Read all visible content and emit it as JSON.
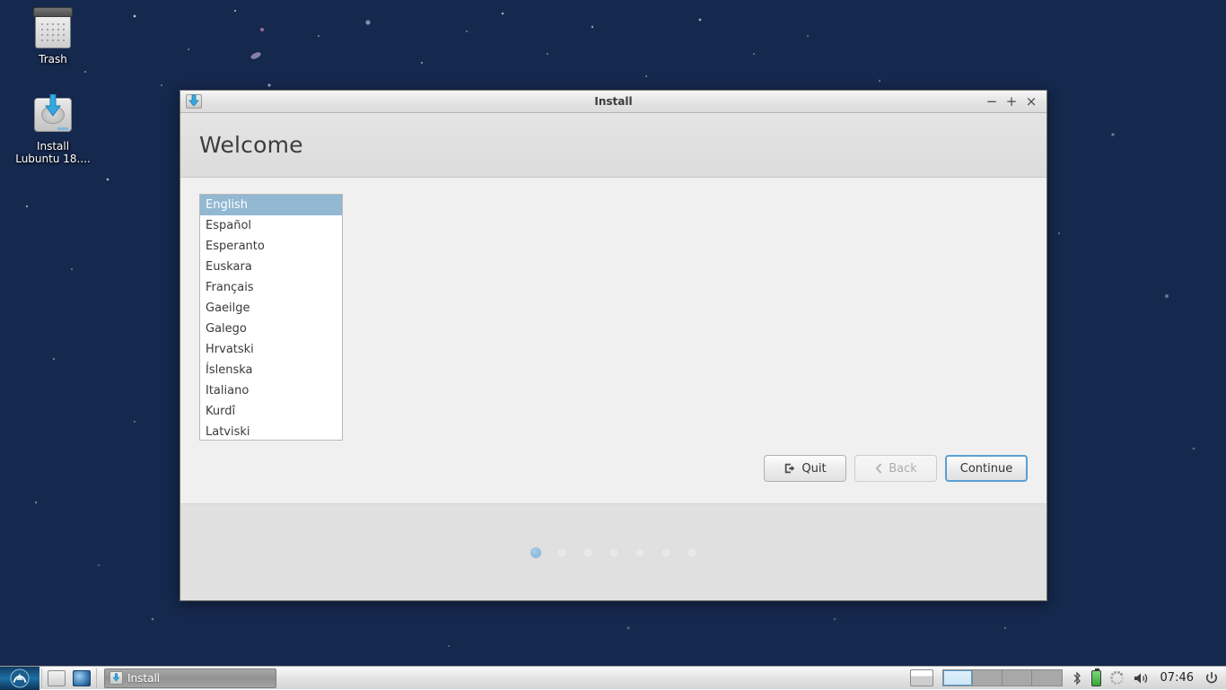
{
  "desktop": {
    "icons": [
      {
        "name": "trash",
        "label": "Trash"
      },
      {
        "name": "install-lubuntu",
        "label": "Install\nLubuntu 18...."
      }
    ],
    "wallpaper_colors": {
      "top_left": "#123a5c",
      "top_right": "#8a2ad2",
      "bottom_left": "#4a0c6d",
      "bottom_right": "#2a0943"
    }
  },
  "window": {
    "title": "Install",
    "icon": "installer-icon",
    "controls": {
      "minimize": "−",
      "maximize": "+",
      "close": "×"
    },
    "page_title": "Welcome",
    "language_list": {
      "selected": "English",
      "items": [
        "English",
        "Español",
        "Esperanto",
        "Euskara",
        "Français",
        "Gaeilge",
        "Galego",
        "Hrvatski",
        "Íslenska",
        "Italiano",
        "Kurdî",
        "Latviski"
      ]
    },
    "buttons": {
      "quit": {
        "label": "Quit",
        "icon": "exit-icon",
        "enabled": true
      },
      "back": {
        "label": "Back",
        "icon": "chevron-left-icon",
        "enabled": false
      },
      "continue": {
        "label": "Continue",
        "enabled": true,
        "focused": true
      }
    },
    "progress": {
      "total_steps": 7,
      "current_step": 1,
      "active_color": "#7aafd4",
      "inactive_color": "#e8e8e8"
    },
    "colors": {
      "header_bg": "#e0e0e0",
      "body_bg": "#f0f0f0",
      "footer_bg": "#e0e0e0",
      "selection_bg": "#92b8d2"
    }
  },
  "taskbar": {
    "start_button": "lubuntu-logo-icon",
    "launchers": [
      {
        "name": "file-manager-icon",
        "title": "File Manager"
      },
      {
        "name": "web-browser-icon",
        "title": "Web Browser"
      }
    ],
    "tasks": [
      {
        "label": "Install",
        "icon": "installer-icon",
        "active": true
      }
    ],
    "tray": {
      "show_desktop": "show-desktop-icon",
      "workspaces": {
        "count": 4,
        "active": 1
      },
      "bluetooth": "ᛦ",
      "battery": "battery-icon",
      "updates": "spinner-icon",
      "volume": "🔊",
      "clock": "07:46",
      "power": "⏻"
    }
  }
}
